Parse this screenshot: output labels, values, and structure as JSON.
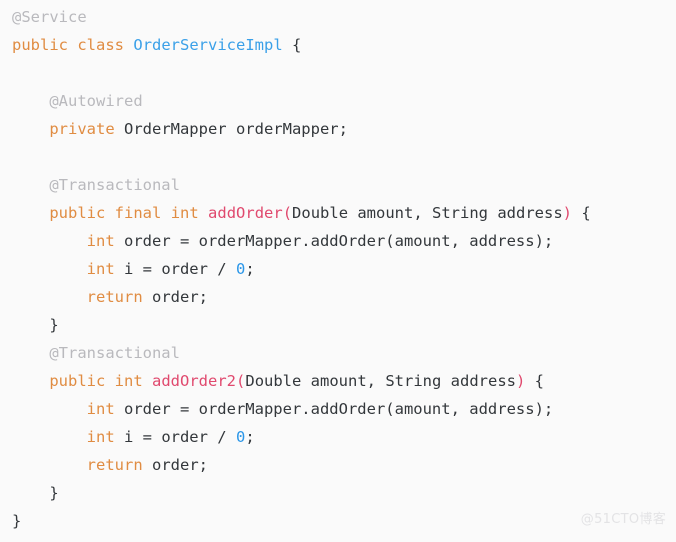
{
  "editor": {
    "language": "java",
    "background_color": "#fafafa",
    "font_family_kind": "monospace",
    "colors": {
      "annotation": "#b9b9bd",
      "keyword": "#e08c42",
      "class_name": "#3aa0e8",
      "method_name": "#e0496e",
      "number": "#2a96e8",
      "plain_text": "#33373b",
      "watermark": "#e3e3e5"
    },
    "indent_unit_spaces": 4,
    "line_height_px": 28
  },
  "watermark": {
    "text": "@51CTO博客"
  },
  "code": {
    "full_text": "@Service\npublic class OrderServiceImpl {\n\n    @Autowired\n    private OrderMapper orderMapper;\n\n    @Transactional\n    public final int addOrder(Double amount, String address) {\n        int order = orderMapper.addOrder(amount, address);\n        int i = order / 0;\n        return order;\n    }\n    @Transactional\n    public int addOrder2(Double amount, String address) {\n        int order = orderMapper.addOrder(amount, address);\n        int i = order / 0;\n        return order;\n    }\n}",
    "lines": [
      {
        "index": 1,
        "indent": 0,
        "tokens": [
          {
            "t": "@Service",
            "k": "annotation"
          }
        ]
      },
      {
        "index": 2,
        "indent": 0,
        "tokens": [
          {
            "t": "public",
            "k": "keyword"
          },
          {
            "t": " ",
            "k": "plain"
          },
          {
            "t": "class",
            "k": "keyword"
          },
          {
            "t": " ",
            "k": "plain"
          },
          {
            "t": "OrderServiceImpl",
            "k": "classname"
          },
          {
            "t": " {",
            "k": "punct"
          }
        ]
      },
      {
        "index": 3,
        "indent": 0,
        "tokens": []
      },
      {
        "index": 4,
        "indent": 4,
        "tokens": [
          {
            "t": "@Autowired",
            "k": "annotation"
          }
        ]
      },
      {
        "index": 5,
        "indent": 4,
        "tokens": [
          {
            "t": "private",
            "k": "keyword"
          },
          {
            "t": " OrderMapper orderMapper;",
            "k": "plain"
          }
        ]
      },
      {
        "index": 6,
        "indent": 0,
        "tokens": []
      },
      {
        "index": 7,
        "indent": 4,
        "tokens": [
          {
            "t": "@Transactional",
            "k": "annotation"
          }
        ]
      },
      {
        "index": 8,
        "indent": 4,
        "tokens": [
          {
            "t": "public",
            "k": "keyword"
          },
          {
            "t": " ",
            "k": "plain"
          },
          {
            "t": "final",
            "k": "keyword"
          },
          {
            "t": " ",
            "k": "plain"
          },
          {
            "t": "int",
            "k": "keyword"
          },
          {
            "t": " ",
            "k": "plain"
          },
          {
            "t": "addOrder",
            "k": "method"
          },
          {
            "t": "(",
            "k": "method"
          },
          {
            "t": "Double amount, String address",
            "k": "plain"
          },
          {
            "t": ")",
            "k": "method"
          },
          {
            "t": " {",
            "k": "punct"
          }
        ]
      },
      {
        "index": 9,
        "indent": 8,
        "tokens": [
          {
            "t": "int",
            "k": "keyword"
          },
          {
            "t": " order = orderMapper.addOrder(amount, address);",
            "k": "plain"
          }
        ]
      },
      {
        "index": 10,
        "indent": 8,
        "tokens": [
          {
            "t": "int",
            "k": "keyword"
          },
          {
            "t": " i = order / ",
            "k": "plain"
          },
          {
            "t": "0",
            "k": "number"
          },
          {
            "t": ";",
            "k": "plain"
          }
        ]
      },
      {
        "index": 11,
        "indent": 8,
        "tokens": [
          {
            "t": "return",
            "k": "keyword"
          },
          {
            "t": " order;",
            "k": "plain"
          }
        ]
      },
      {
        "index": 12,
        "indent": 4,
        "tokens": [
          {
            "t": "}",
            "k": "punct"
          }
        ]
      },
      {
        "index": 13,
        "indent": 4,
        "tokens": [
          {
            "t": "@Transactional",
            "k": "annotation"
          }
        ]
      },
      {
        "index": 14,
        "indent": 4,
        "tokens": [
          {
            "t": "public",
            "k": "keyword"
          },
          {
            "t": " ",
            "k": "plain"
          },
          {
            "t": "int",
            "k": "keyword"
          },
          {
            "t": " ",
            "k": "plain"
          },
          {
            "t": "addOrder2",
            "k": "method"
          },
          {
            "t": "(",
            "k": "method"
          },
          {
            "t": "Double amount, String address",
            "k": "plain"
          },
          {
            "t": ")",
            "k": "method"
          },
          {
            "t": " {",
            "k": "punct"
          }
        ]
      },
      {
        "index": 15,
        "indent": 8,
        "tokens": [
          {
            "t": "int",
            "k": "keyword"
          },
          {
            "t": " order = orderMapper.addOrder(amount, address);",
            "k": "plain"
          }
        ]
      },
      {
        "index": 16,
        "indent": 8,
        "tokens": [
          {
            "t": "int",
            "k": "keyword"
          },
          {
            "t": " i = order / ",
            "k": "plain"
          },
          {
            "t": "0",
            "k": "number"
          },
          {
            "t": ";",
            "k": "plain"
          }
        ]
      },
      {
        "index": 17,
        "indent": 8,
        "tokens": [
          {
            "t": "return",
            "k": "keyword"
          },
          {
            "t": " order;",
            "k": "plain"
          }
        ]
      },
      {
        "index": 18,
        "indent": 4,
        "tokens": [
          {
            "t": "}",
            "k": "punct"
          }
        ]
      },
      {
        "index": 19,
        "indent": 0,
        "tokens": [
          {
            "t": "}",
            "k": "punct"
          }
        ]
      }
    ]
  }
}
